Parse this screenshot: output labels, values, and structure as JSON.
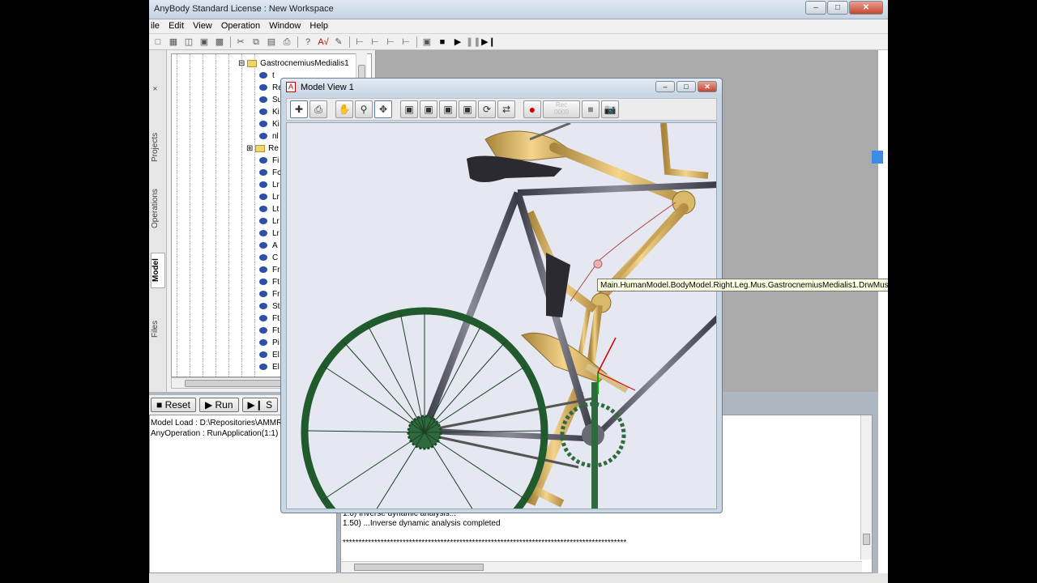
{
  "window": {
    "title": "AnyBody    Standard License :  New Workspace",
    "controls": [
      "–",
      "□",
      "✕"
    ]
  },
  "menu": [
    "ile",
    "Edit",
    "View",
    "Operation",
    "Window",
    "Help"
  ],
  "toolbar": {
    "icons": [
      "new-file-icon",
      "new-project-icon",
      "open-icon",
      "save-icon",
      "save-all-icon",
      "cut-icon",
      "copy-icon",
      "paste-icon",
      "print-icon",
      "help-icon",
      "spell-icon",
      "load-icon",
      "tree-1-icon",
      "tree-2-icon",
      "tree-3-icon",
      "tree-4-icon",
      "tree-5-icon",
      "stop-icon",
      "play-icon",
      "pause-icon",
      "step-icon"
    ]
  },
  "side_tabs": {
    "close": "×",
    "projects": "Projects",
    "operations": "Operations",
    "model": "Model",
    "files": "Files"
  },
  "tree": {
    "root": "GastrocnemiusMedialis1",
    "rows": [
      {
        "label": "t",
        "type": "var"
      },
      {
        "label": "Re",
        "type": "var"
      },
      {
        "label": "Su",
        "type": "var"
      },
      {
        "label": "Ki",
        "type": "var"
      },
      {
        "label": "Ki",
        "type": "var"
      },
      {
        "label": "nl",
        "type": "var"
      },
      {
        "label": "Re",
        "type": "folder"
      },
      {
        "label": "Fi",
        "type": "var"
      },
      {
        "label": "Fc",
        "type": "var"
      },
      {
        "label": "Lr",
        "type": "var"
      },
      {
        "label": "Lr",
        "type": "var"
      },
      {
        "label": "Lt",
        "type": "var"
      },
      {
        "label": "Lr",
        "type": "var"
      },
      {
        "label": "Lr",
        "type": "var"
      },
      {
        "label": "A",
        "type": "var"
      },
      {
        "label": "C",
        "type": "var"
      },
      {
        "label": "Fr",
        "type": "var"
      },
      {
        "label": "Ft",
        "type": "var"
      },
      {
        "label": "Fr",
        "type": "var"
      },
      {
        "label": "St",
        "type": "var"
      },
      {
        "label": "Ft",
        "type": "var"
      },
      {
        "label": "Ft",
        "type": "var"
      },
      {
        "label": "Pi",
        "type": "var"
      },
      {
        "label": "El",
        "type": "var"
      },
      {
        "label": "El",
        "type": "var"
      }
    ]
  },
  "run_controls": {
    "reset": "Reset",
    "run": "Run",
    "step": "S"
  },
  "messages_left": [
    "Model Load : D:\\Repositories\\AMMR",
    "AnyOperation : RunApplication(1:1) :"
  ],
  "messages_right": [
    "1.0) Inverse dynamic analysis...",
    "1.50) ...Inverse dynamic analysis completed",
    "******************************************************************************************"
  ],
  "model_view": {
    "title": "Model View 1",
    "tools": [
      "xyz-axes-icon",
      "print-icon",
      "pan-icon",
      "zoom-box-icon",
      "rotate-icon",
      "zoom-fit-icon",
      "view-front-icon",
      "view-side-icon",
      "view-top-icon",
      "rotate-view-icon",
      "animate-icon",
      "record-icon",
      "frames-icon",
      "stop-record-icon",
      "camera-icon"
    ],
    "frames_label": "Rec\n0000"
  },
  "tooltip": "Main.HumanModel.BodyModel.Right.Leg.Mus.GastrocnemiusMedialis1.DrwMus"
}
